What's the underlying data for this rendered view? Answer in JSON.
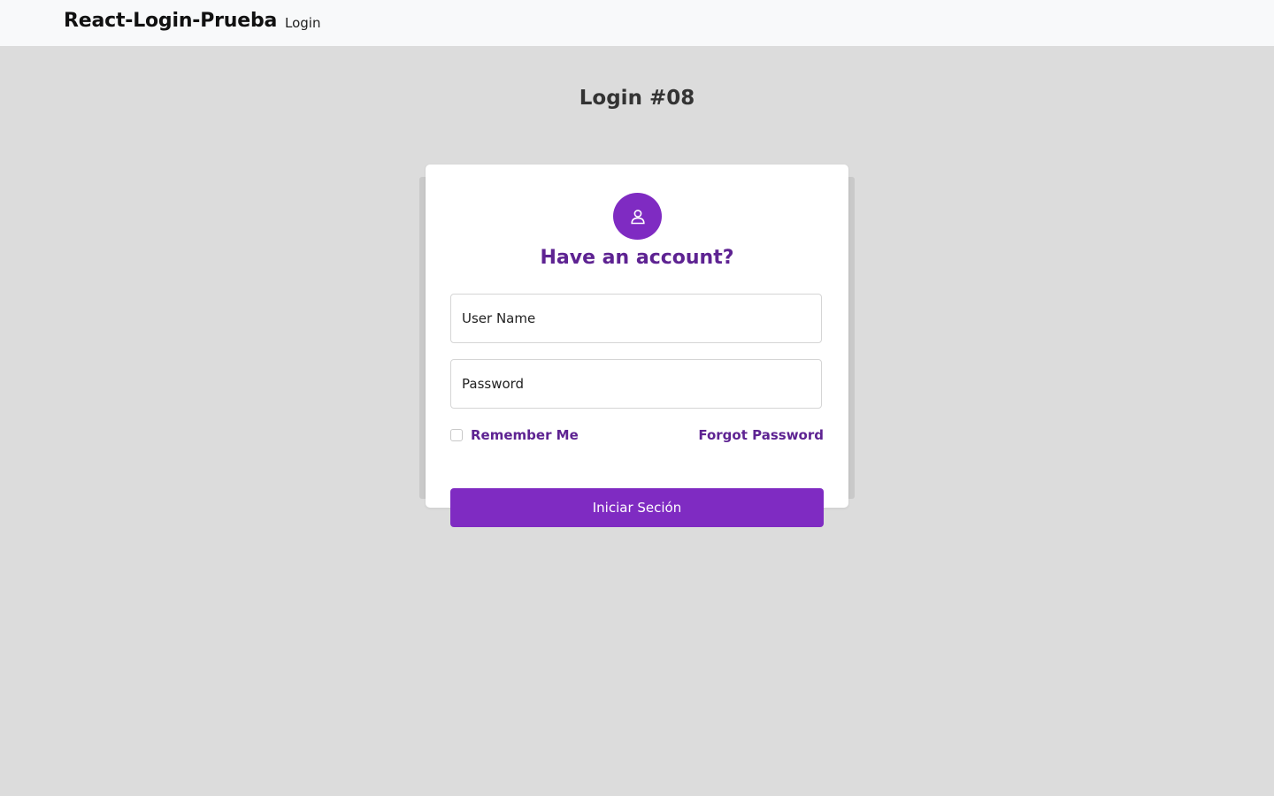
{
  "navbar": {
    "brand": "React-Login-Prueba",
    "links": [
      {
        "label": "Login"
      }
    ]
  },
  "page": {
    "heading": "Login #08"
  },
  "card": {
    "icon": "user-icon",
    "title": "Have an account?",
    "username_placeholder": "User Name",
    "password_placeholder": "Password",
    "remember_label": "Remember Me",
    "remember_checked": false,
    "forgot_label": "Forgot Password",
    "submit_label": "Iniciar Seción"
  },
  "colors": {
    "accent": "#7f2bc2",
    "accent_text": "#5e2392",
    "background": "#dcdcdc",
    "navbar_bg": "#f8f9fa"
  }
}
